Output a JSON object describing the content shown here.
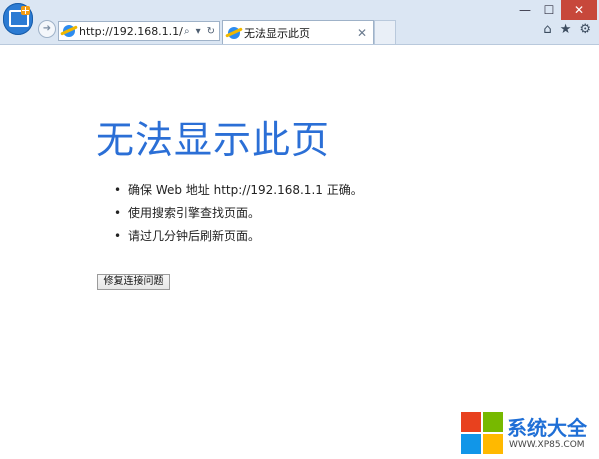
{
  "browser": {
    "address_url": "http://192.168.1.1/",
    "tab_title": "无法显示此页",
    "tab_close": "✕",
    "window_controls": {
      "minimize": "—",
      "maximize": "☐",
      "close": "✕"
    },
    "icons": [
      "back-icon",
      "search-icon",
      "dropdown-icon",
      "refresh-icon",
      "home-icon",
      "favorites-star-icon",
      "settings-gear-icon"
    ]
  },
  "page": {
    "title": "无法显示此页",
    "bullets": [
      "确保 Web 地址 http://192.168.1.1 正确。",
      "使用搜索引擎查找页面。",
      "请过几分钟后刷新页面。"
    ],
    "fix_button_label": "修复连接问题"
  },
  "watermark": {
    "name": "系统大全",
    "url": "WWW.XP85.COM"
  },
  "colors": {
    "title_blue": "#2b6fd6",
    "chrome_bg": "#dbe6f3",
    "close_red": "#c7483b"
  }
}
